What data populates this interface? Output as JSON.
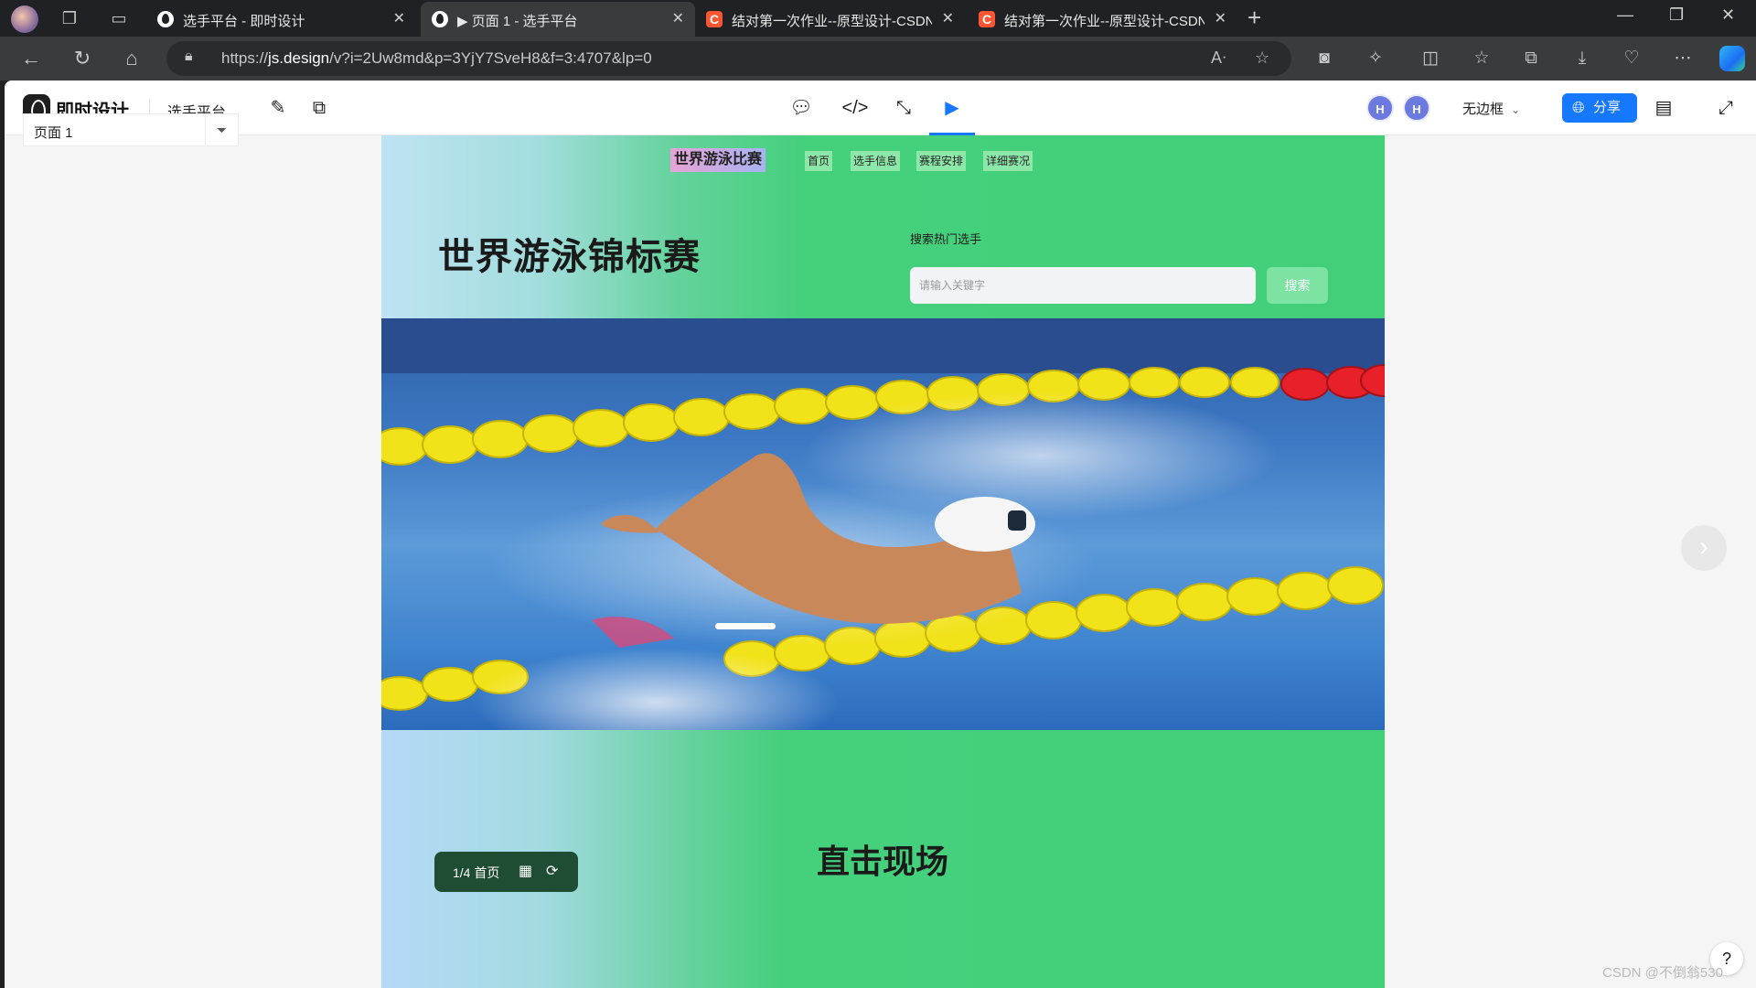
{
  "browser": {
    "tabs": [
      {
        "title": "选手平台 - 即时设计",
        "favicon": "js-design-icon",
        "active": false
      },
      {
        "title": "▶ 页面 1 - 选手平台",
        "favicon": "js-design-icon",
        "active": true
      },
      {
        "title": "结对第一次作业--原型设计-CSDN",
        "favicon": "csdn-icon",
        "active": false
      },
      {
        "title": "结对第一次作业--原型设计-CSDN",
        "favicon": "csdn-icon",
        "active": false
      }
    ],
    "url_prefix": "https://",
    "url_host": "js.design",
    "url_path": "/v?i=2Uw8md&p=3YjY7SveH8&f=3:4707&lp=0"
  },
  "app": {
    "brand": "即时设计",
    "project_name": "选手平台",
    "avatars": [
      "H",
      "H"
    ],
    "frame_mode": "无边框",
    "share_label": "分享",
    "accent_color": "#1677ff"
  },
  "sidebar": {
    "page_label": "页面 1"
  },
  "prototype": {
    "site_title": "世界游泳比赛",
    "nav": [
      "首页",
      "选手信息",
      "赛程安排",
      "详细赛况"
    ],
    "hero_title": "世界游泳锦标赛",
    "search_label": "搜索热门选手",
    "search_placeholder": "请输入关键字",
    "search_button": "搜索",
    "section_title": "直击现场",
    "theme_color": "#43cf7a"
  },
  "pager": {
    "label": "1/4 首页"
  },
  "help": "?",
  "watermark": "CSDN @不倒翁530"
}
